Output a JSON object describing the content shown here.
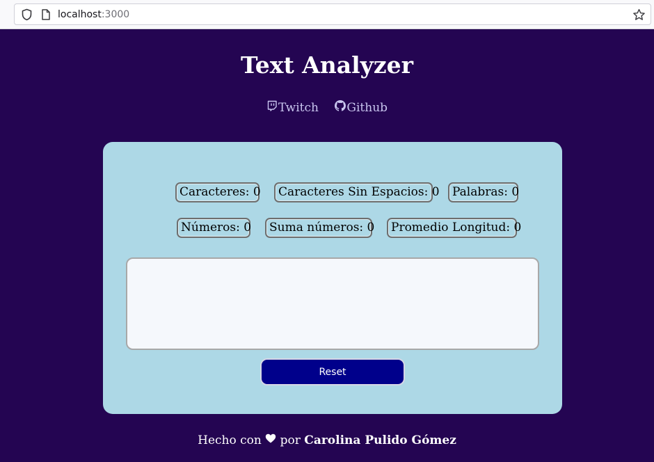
{
  "browser": {
    "url_host": "localhost",
    "url_port": ":3000"
  },
  "page": {
    "title": "Text Analyzer",
    "links": [
      {
        "label": "Twitch",
        "icon": "twitch-icon"
      },
      {
        "label": "Github",
        "icon": "github-icon"
      }
    ]
  },
  "stats": {
    "characters": "Caracteres: 0",
    "characters_no_spaces": "Caracteres Sin Espacios: 0",
    "words": "Palabras: 0",
    "numbers": "Números: 0",
    "numbers_sum": "Suma números: 0",
    "average_length": "Promedio Longitud: 0"
  },
  "input": {
    "value": "",
    "placeholder": ""
  },
  "reset_label": "Reset",
  "footer": {
    "prefix": "Hecho con",
    "icon": "heart-icon",
    "middle": "por",
    "author": "Carolina Pulido Gómez"
  },
  "colors": {
    "background": "#240552",
    "card": "#add8e6",
    "button": "#00008b",
    "link": "#c9c6ef"
  }
}
